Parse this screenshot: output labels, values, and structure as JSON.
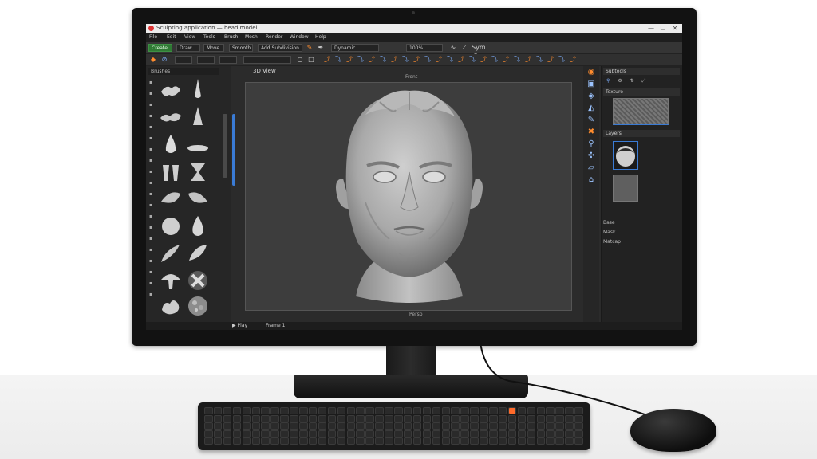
{
  "window": {
    "title": "Sculpting application — head model",
    "controls": {
      "minimize": "—",
      "maximize": "☐",
      "close": "✕"
    }
  },
  "menubar": [
    "File",
    "Edit",
    "View",
    "Tools",
    "Brush",
    "Mesh",
    "Render",
    "Window",
    "Help"
  ],
  "toolbar": {
    "create_label": "Create",
    "fields": [
      "Draw",
      "Move",
      "Smooth",
      "Add Subdivision",
      "Dynamic"
    ],
    "zoom_value": "100%",
    "symmetry_label": "Sym X"
  },
  "left_panel": {
    "header": "Brushes",
    "tab_label": "Tools"
  },
  "viewport": {
    "tab_label": "3D View",
    "top_label": "Front",
    "bottom_label": "Persp"
  },
  "right_panel": {
    "header_top": "Subtools",
    "section_texture": "Texture",
    "section_layers": "Layers",
    "row_labels": [
      "Base",
      "Mask",
      "Matcap"
    ]
  },
  "statusbar": {
    "play_label": "▶ Play",
    "frame_label": "Frame 1"
  },
  "colors": {
    "accent_orange": "#ff8c2e",
    "accent_blue": "#3a7bd5",
    "create_green": "#2f7a34"
  }
}
